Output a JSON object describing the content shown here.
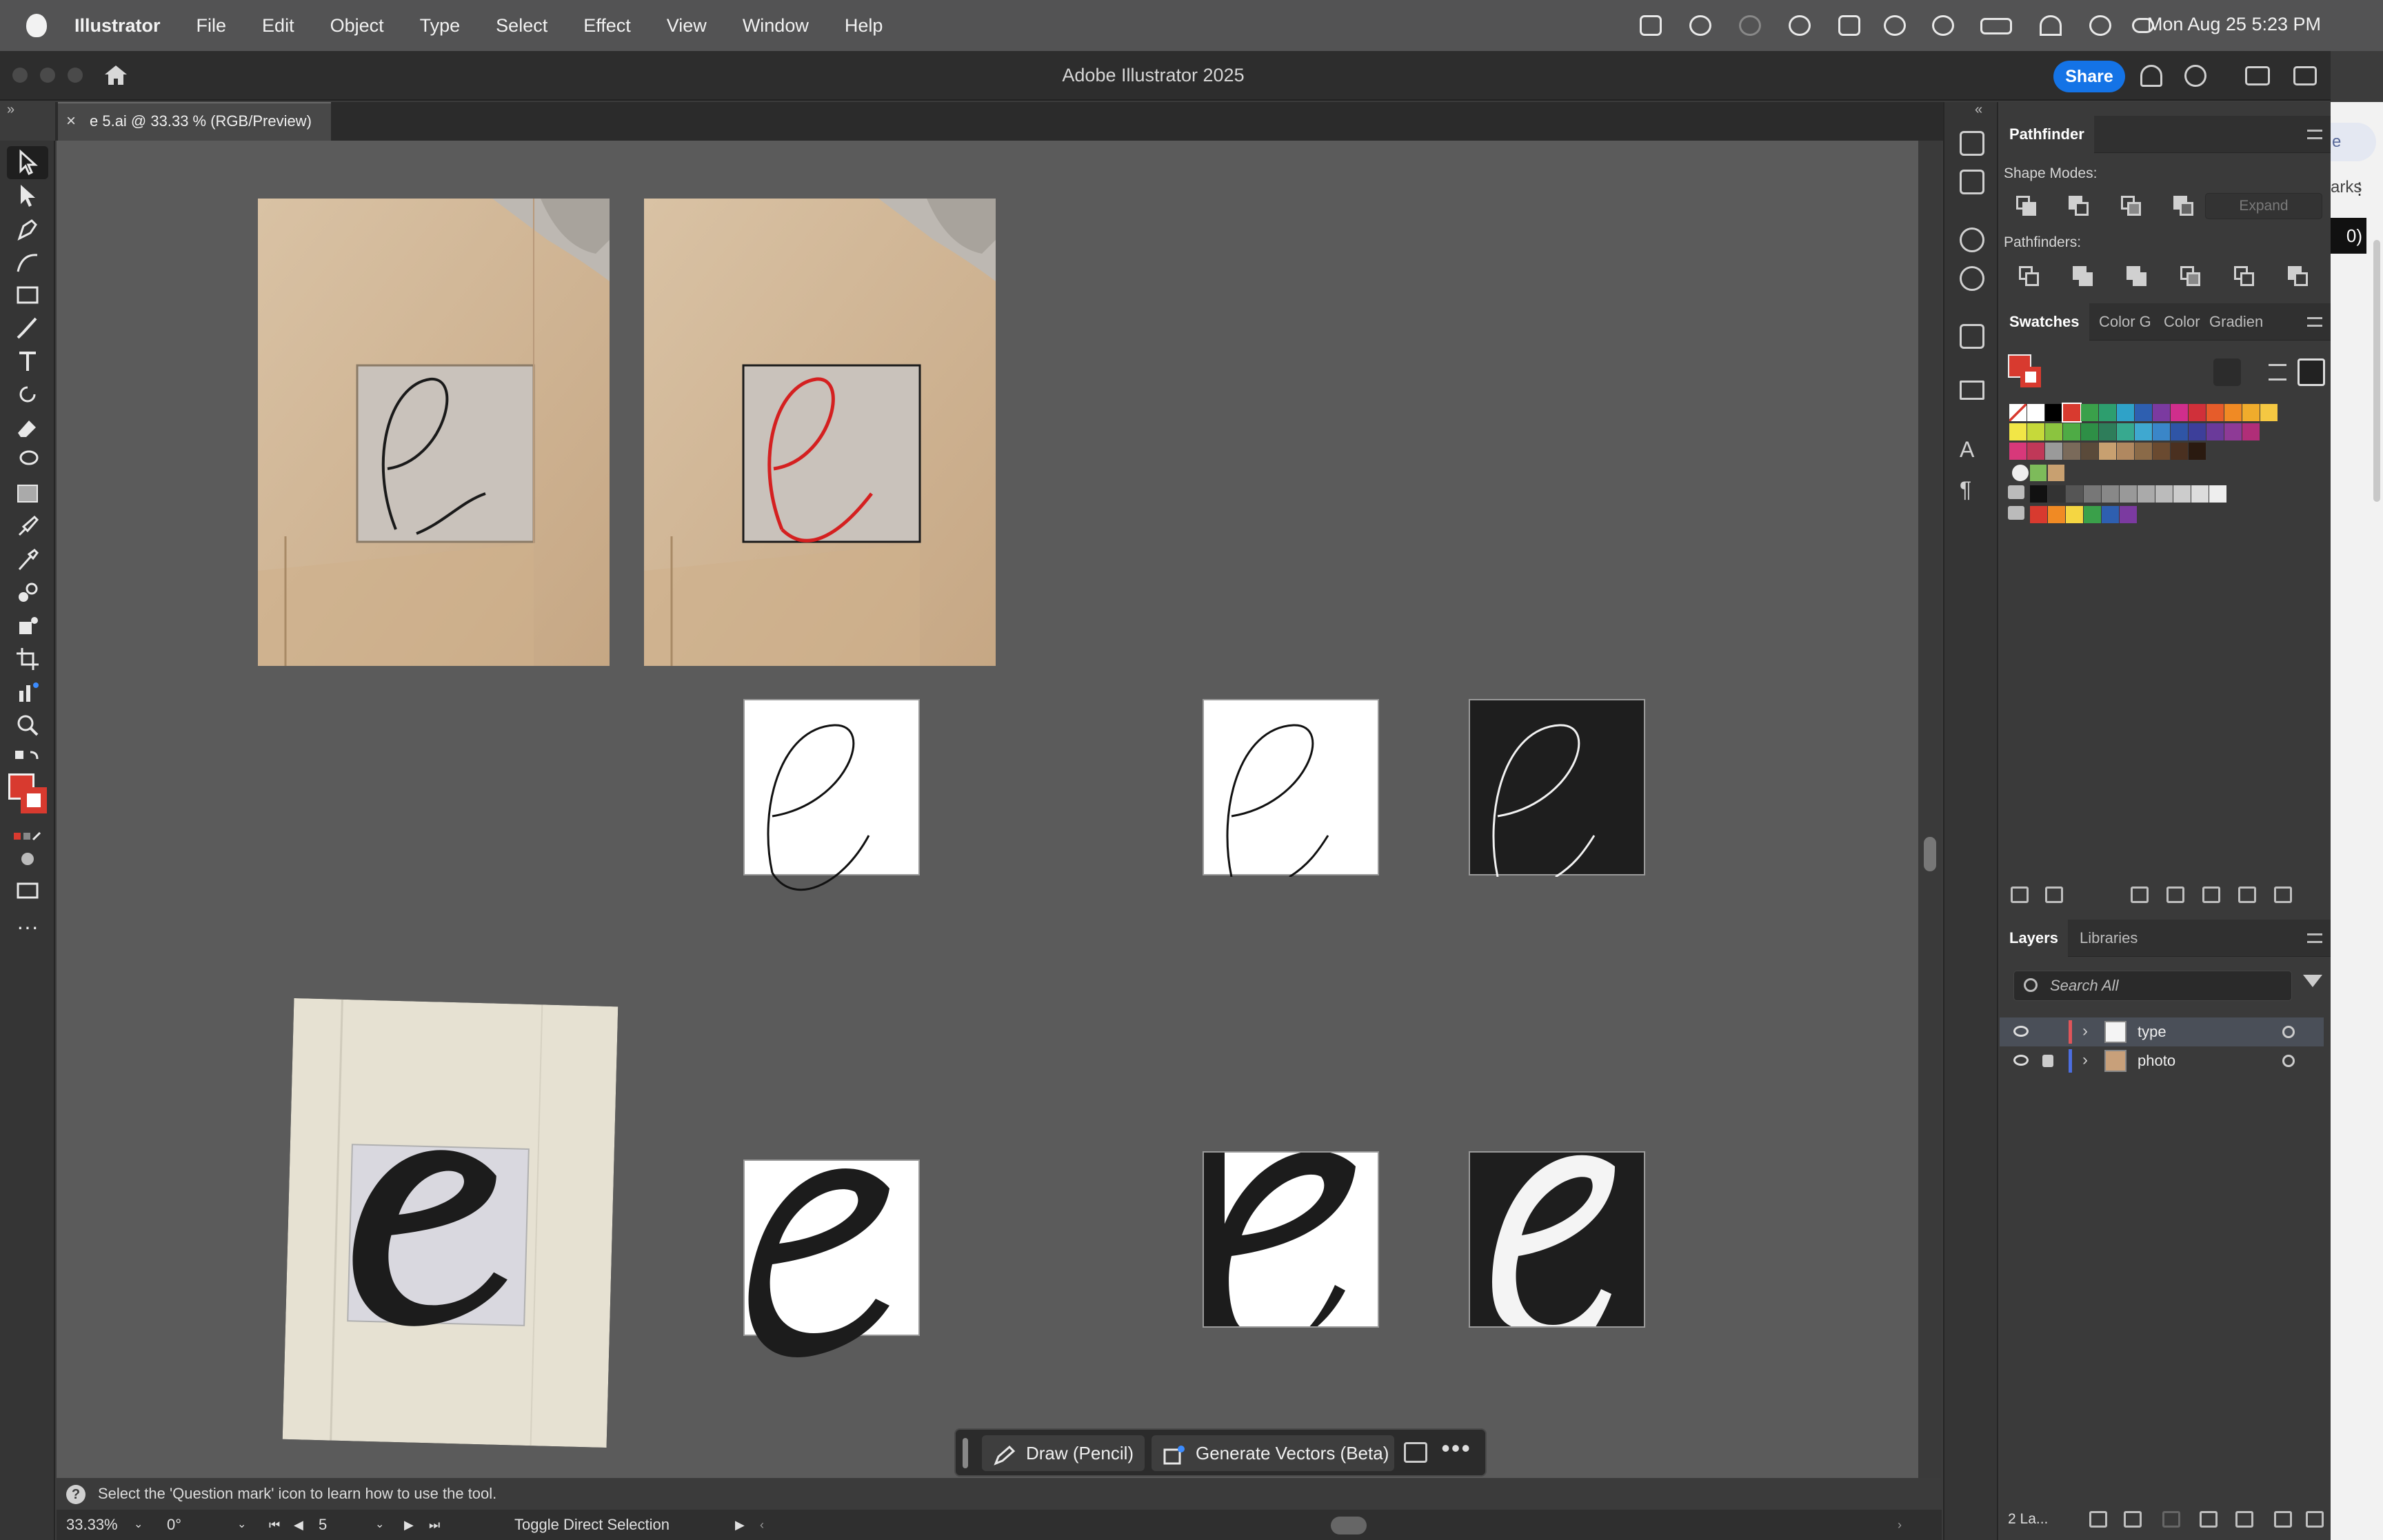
{
  "menubar": {
    "app": "Illustrator",
    "menus": [
      "File",
      "Edit",
      "Object",
      "Type",
      "Select",
      "Effect",
      "View",
      "Window",
      "Help"
    ],
    "clock": "Mon Aug 25  5:23 PM"
  },
  "appbar": {
    "title": "Adobe Illustrator 2025",
    "share": "Share"
  },
  "document": {
    "tab": "e 5.ai @ 33.33 % (RGB/Preview)",
    "close": "×"
  },
  "colors": {
    "fill": "#d83a2f",
    "accent": "#1473e6",
    "layer_type": "#e0555a",
    "layer_photo": "#4c6ee0"
  },
  "context_bar": {
    "draw": "Draw (Pencil)",
    "generate": "Generate Vectors (Beta)",
    "more": "•••"
  },
  "tip": {
    "text": "Select the 'Question mark' icon to learn how to use the tool."
  },
  "status": {
    "zoom": "33.33%",
    "rotation": "0°",
    "artboard": "5",
    "tool": "Toggle Direct Selection"
  },
  "pathfinder": {
    "title": "Pathfinder",
    "shape_modes": "Shape Modes:",
    "pathfinders": "Pathfinders:",
    "expand": "Expand"
  },
  "swatches": {
    "tabs": [
      "Swatches",
      "Color G",
      "Color",
      "Gradien"
    ],
    "row1": [
      "#ffffff",
      "#ffffff",
      "#000000",
      "#d83a2f",
      "#3aa04a",
      "#2d9e6e",
      "#2fa2c8",
      "#2e5fb0",
      "#7b3aa0",
      "#d02e8c",
      "#d0303a",
      "#e65c2a",
      "#f08a24",
      "#f0ac2c",
      "#f5c842"
    ],
    "row2": [
      "#f2e646",
      "#c6d93a",
      "#8bc43f",
      "#4eab45",
      "#2e8f46",
      "#2e7d5a",
      "#37a98f",
      "#3fa8d0",
      "#3a86c8",
      "#2f55a6",
      "#3d3f9a",
      "#6a3a9a",
      "#8e3a96",
      "#b02e78"
    ],
    "row3": [
      "#d8387a",
      "#c03858",
      "#9a9a9a",
      "#7a6a5a",
      "#5a4a3a",
      "#c8a070",
      "#b08860",
      "#8a6a48",
      "#6a4a30",
      "#4a3020",
      "#2a1a10"
    ],
    "row5": [
      "#111111",
      "#333333",
      "#555555",
      "#777777",
      "#888888",
      "#999999",
      "#aaaaaa",
      "#bbbbbb",
      "#cccccc",
      "#dddddd",
      "#eeeeee"
    ],
    "row6": [
      "#d83a2f",
      "#f08a24",
      "#f5d642",
      "#3aa04a",
      "#2e5fb0",
      "#7b3aa0"
    ]
  },
  "layers": {
    "tabs": [
      "Layers",
      "Libraries"
    ],
    "search": "Search All",
    "items": [
      {
        "name": "type"
      },
      {
        "name": "photo"
      }
    ],
    "count": "2 La..."
  },
  "sliver": {
    "a": "e",
    "b": "arks",
    "c": "0)"
  }
}
